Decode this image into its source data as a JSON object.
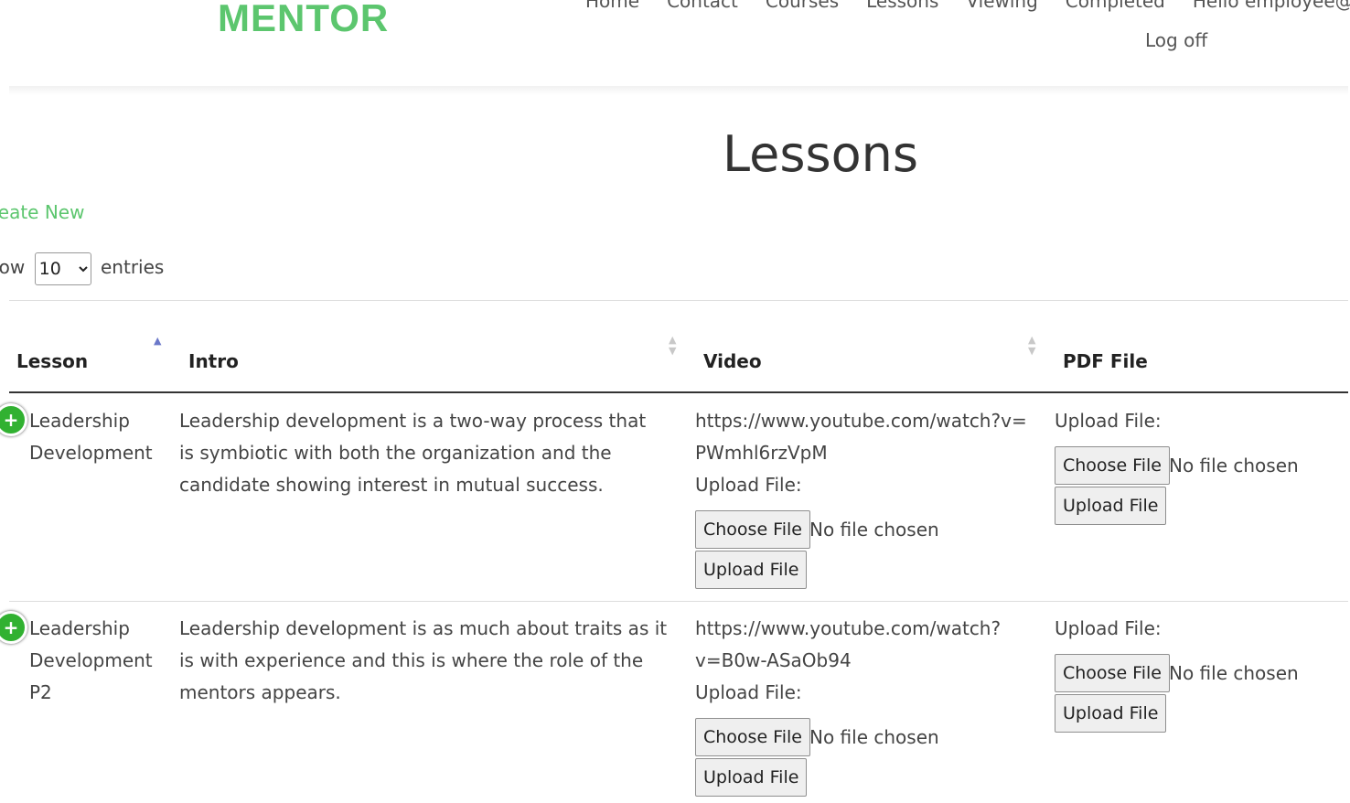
{
  "header": {
    "brand": "MENTOR",
    "nav": [
      "Home",
      "Contact",
      "Courses",
      "Lessons",
      "Viewing",
      "Completed",
      "Hello employee@elan"
    ],
    "logoff_label": "Log off"
  },
  "page": {
    "title": "Lessons",
    "create_new_label": "reate New",
    "show_label": "how",
    "entries_label": "entries",
    "page_length": "10",
    "page_length_options": [
      "10"
    ]
  },
  "table": {
    "columns": [
      "Lesson",
      "Intro",
      "Video",
      "PDF File"
    ],
    "sorted_column": "Lesson",
    "expand_icon": "plus-circle-icon",
    "upload_label": "Upload File:",
    "choose_file_label": "Choose File",
    "no_file_label": "No file chosen",
    "upload_button_label": "Upload File",
    "rows": [
      {
        "lesson": "Leadership Development",
        "intro": "Leadership development is a two-way process that is symbiotic with both the organization and the candidate showing interest in mutual success.",
        "video": "https://www.youtube.com/watch?v=PWmhl6rzVpM"
      },
      {
        "lesson": "Leadership Development P2",
        "intro": "Leadership development is as much about traits as it is with experience and this is where the role of the mentors appears.",
        "video": "https://www.youtube.com/watch?v=B0w-ASaOb94"
      }
    ]
  },
  "colors": {
    "accent": "#5cc66e",
    "expand": "#31b131",
    "sort_active": "#6b78c9"
  }
}
